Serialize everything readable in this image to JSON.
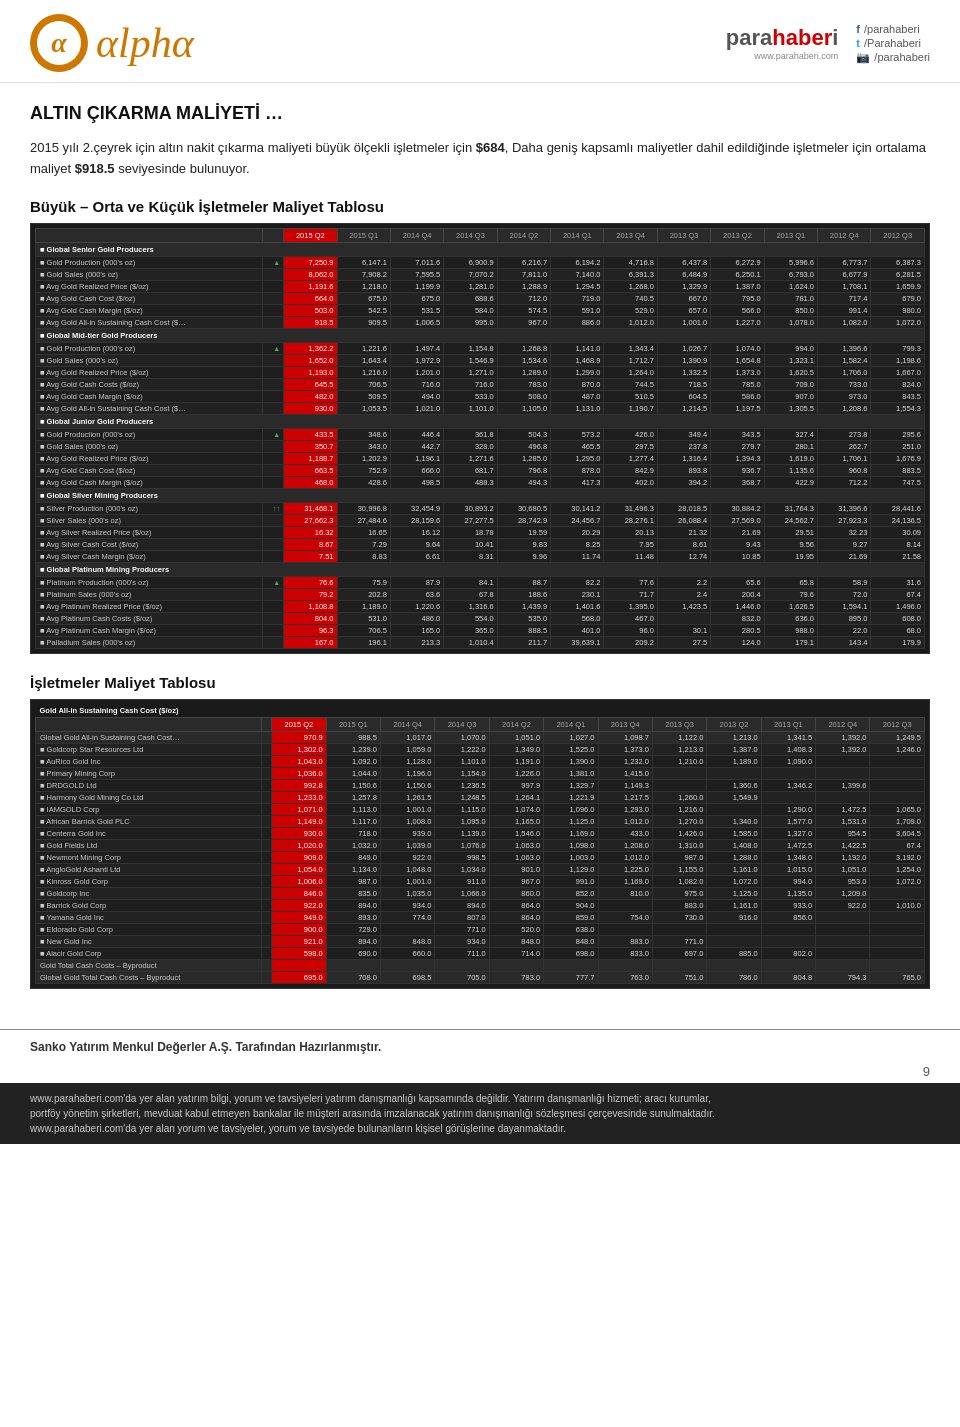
{
  "header": {
    "alpha_brand": "alpha",
    "alpha_symbol": "α",
    "parahaberi_name": "parahaberi",
    "parahaberi_url": "www.parahaberi.com",
    "social": {
      "facebook": "/parahaberi",
      "twitter": "/Parahaberi",
      "instagram": "/parahaberi"
    }
  },
  "page_title": "ALTIN ÇIKARMA MALİYETİ …",
  "body_text1": "2015 yılı 2.çeyrek için altın nakit çıkarma maliyeti büyük ölçekli işletmeler için ",
  "body_highlight1": "$684",
  "body_text2": ", Daha geniş kapsamlı maliyetler dahil edildiğinde işletmeler için ortalama maliyet ",
  "body_highlight2": "$918.5",
  "body_text3": " seviyesinde bulunuyor.",
  "section1_title": "Büyük – Orta ve Küçük İşletmeler Maliyet Tablosu",
  "section2_title": "İşletmeler Maliyet Tablosu",
  "table1": {
    "headers": [
      "",
      "",
      "2015 Q2",
      "2015 Q1",
      "2014 Q4",
      "2014 Q3",
      "2014 Q2",
      "2014 Q1",
      "2013 Q4",
      "2013 Q3",
      "2013 Q2",
      "2013 Q1",
      "2012 Q4",
      "2012 Q3"
    ],
    "sections": [
      {
        "name": "Global Senior Gold Producers",
        "rows": [
          [
            "Gold Production (000's oz)",
            "↑",
            "7,250.9",
            "6,147.1",
            "7,011.6",
            "6,900.9",
            "6,216.7",
            "6,194.2",
            "4,716.8",
            "6,437.8",
            "6,272.9",
            "5,996.6",
            "6,773.7",
            "6,387.3"
          ],
          [
            "Gold Sales (000's oz)",
            "",
            "8,062.0",
            "7,908.2",
            "7,595.5",
            "7,070.2",
            "7,811.0",
            "7,140.0",
            "6,391.3",
            "6,484.9",
            "6,250.1",
            "6,793.0",
            "6,677.9",
            "6,281.5"
          ],
          [
            "Avg Gold Realized Price ($/oz)",
            "",
            "1,191.6",
            "1,218.0",
            "1,199.9",
            "1,281.0",
            "1,288.9",
            "1,294.5",
            "1,268.0",
            "1,329.9",
            "1,387.0",
            "1,624.0",
            "1,708.1",
            "1,659.9"
          ],
          [
            "Avg Gold Cash Cost ($/oz)",
            "",
            "664.0",
            "675.0",
            "675.0",
            "688.6",
            "712.0",
            "719.0",
            "740.5",
            "667.0",
            "795.0",
            "781.0",
            "717.4",
            "679.0"
          ],
          [
            "Avg Gold Cash Margin ($/oz)",
            "",
            "503.0",
            "542.5",
            "531.5",
            "584.0",
            "574.5",
            "591.0",
            "529.0",
            "657.0",
            "566.0",
            "850.0",
            "991.4",
            "980.0"
          ],
          [
            "Avg Gold All-in Sustaining Cash Cost ($…",
            "",
            "918.5",
            "909.5",
            "1,006.5",
            "995.0",
            "967.0",
            "886.0",
            "1,012.0",
            "1,001.0",
            "1,227.0",
            "1,078.0",
            "1,082.0",
            "1,072.0"
          ]
        ]
      },
      {
        "name": "Global Mid-tier Gold Producers",
        "rows": [
          [
            "Gold Production (000's oz)",
            "↑",
            "1,362.2",
            "1,221.6",
            "1,497.4",
            "1,154.8",
            "1,268.8",
            "1,141.0",
            "1,343.4",
            "1,026.7",
            "1,074.0",
            "994.0",
            "1,396.6",
            "799.3"
          ],
          [
            "Gold Sales (000's oz)",
            "",
            "1,652.0",
            "1,643.4",
            "1,972.9",
            "1,546.9",
            "1,534.6",
            "1,468.9",
            "1,712.7",
            "1,390.9",
            "1,654.8",
            "1,323.1",
            "1,582.4",
            "1,198.6"
          ],
          [
            "Avg Gold Realized Price ($/oz)",
            "",
            "1,193.0",
            "1,216.0",
            "1,201.0",
            "1,271.0",
            "1,289.0",
            "1,299.0",
            "1,264.0",
            "1,332.5",
            "1,373.0",
            "1,620.5",
            "1,706.0",
            "1,667.0"
          ],
          [
            "Avg Gold Cash Costs ($/oz)",
            "",
            "645.5",
            "706.5",
            "716.0",
            "716.0",
            "783.0",
            "870.0",
            "744.5",
            "718.5",
            "785.0",
            "709.0",
            "733.0",
            "824.0"
          ],
          [
            "Avg Gold Cash Margin ($/oz)",
            "",
            "482.0",
            "509.5",
            "494.0",
            "533.0",
            "508.0",
            "487.0",
            "510.5",
            "604.5",
            "586.0",
            "907.0",
            "973.0",
            "843.5"
          ],
          [
            "Avg Gold All-in Sustaining Cash Cost ($…",
            "",
            "930.0",
            "1,053.5",
            "1,021.0",
            "1,101.0",
            "1,105.0",
            "1,131.0",
            "1,190.7",
            "1,214.5",
            "1,197.5",
            "1,305.5",
            "1,208.6",
            "1,554.3"
          ]
        ]
      },
      {
        "name": "Global Junior Gold Producers",
        "rows": [
          [
            "Gold Production (000's oz)",
            "↑",
            "433.5",
            "348.6",
            "446.4",
            "361.8",
            "504.3",
            "573.2",
            "426.0",
            "349.4",
            "343.5",
            "327.4",
            "273.8",
            "295.6"
          ],
          [
            "Gold Sales (000's oz)",
            "",
            "350.7",
            "343.0",
            "442.7",
            "328.0",
            "496.8",
            "465.5",
            "297.5",
            "237.8",
            "279.7",
            "280.1",
            "262.7",
            "251.0"
          ],
          [
            "Avg Gold Realized Price ($/oz)",
            "",
            "1,188.7",
            "1,202.9",
            "1,196.1",
            "1,271.6",
            "1,285.0",
            "1,295.0",
            "1,277.4",
            "1,316.4",
            "1,394.3",
            "1,619.0",
            "1,706.1",
            "1,676.9"
          ],
          [
            "Avg Gold Cash Cost ($/oz)",
            "",
            "663.5",
            "752.9",
            "666.0",
            "681.7",
            "796.8",
            "878.0",
            "842.9",
            "893.8",
            "936.7",
            "1,135.6",
            "960.8",
            "883.5"
          ],
          [
            "Avg Gold Cash Margin ($/oz)",
            "",
            "468.0",
            "428.6",
            "498.5",
            "488.3",
            "494.3",
            "417.3",
            "402.0",
            "394.2",
            "368.7",
            "422.9",
            "712.2",
            "747.5"
          ]
        ]
      },
      {
        "name": "Global Silver Mining Producers",
        "rows": [
          [
            "Silver Production (000's oz)",
            "↑↑",
            "31,468.1",
            "30,996.8",
            "32,454.9",
            "30,893.2",
            "30,680.5",
            "30,141.2",
            "31,496.3",
            "28,018.5",
            "30,884.2",
            "31,764.3",
            "31,396.6",
            "28,441.6"
          ],
          [
            "Silver Sales (000's oz)",
            "",
            "27,662.3",
            "27,484.6",
            "28,159.6",
            "27,277.5",
            "28,742.9",
            "24,456.7",
            "28,276.1",
            "26,088.4",
            "27,569.0",
            "24,562.7",
            "27,923.3",
            "24,136.5"
          ],
          [
            "Avg Silver Realized Price ($/oz)",
            "",
            "16.32",
            "16.65",
            "16.12",
            "18.78",
            "19.59",
            "20.29",
            "20.13",
            "21.32",
            "21.69",
            "29.51",
            "32.23",
            "30.09"
          ],
          [
            "Avg Silver Cash Cost ($/oz)",
            "",
            "8.67",
            "7.29",
            "9.64",
            "10.41",
            "9.83",
            "8.25",
            "7.95",
            "8.61",
            "9.43",
            "9.56",
            "9.27",
            "8.14"
          ],
          [
            "Avg Silver Cash Margin ($/oz)",
            "",
            "7.51",
            "8.83",
            "6.61",
            "8.31",
            "9.96",
            "11.74",
            "11.48",
            "12.74",
            "10.85",
            "19.95",
            "21.69",
            "21.58"
          ]
        ]
      },
      {
        "name": "Global Platinum Mining Producers",
        "rows": [
          [
            "Platinum Production (000's oz)",
            "↑",
            "76.6",
            "75.9",
            "87.9",
            "84.1",
            "88.7",
            "82.2",
            "77.6",
            "2.2",
            "65.6",
            "65.8",
            "58.9",
            "31.6"
          ],
          [
            "Platinum Sales (000's oz)",
            "",
            "79.2",
            "202.8",
            "63.6",
            "67.8",
            "188.6",
            "230.1",
            "71.7",
            "2.4",
            "200.4",
            "79.6",
            "72.0",
            "67.4"
          ],
          [
            "Avg Platinum Realized Price ($/oz)",
            "",
            "1,108.8",
            "1,189.0",
            "1,220.6",
            "1,316.6",
            "1,439.9",
            "1,401.6",
            "1,395.0",
            "1,423.5",
            "1,446.0",
            "1,626.5",
            "1,594.1",
            "1,496.0"
          ],
          [
            "Avg Platinum Cash Costs ($/oz)",
            "",
            "804.0",
            "531.0",
            "486.0",
            "554.0",
            "535.0",
            "568.0",
            "467.0",
            "",
            "832.0",
            "636.0",
            "895.0",
            "608.0"
          ],
          [
            "Avg Platinum Cash Margin ($/oz)",
            "",
            "96.3",
            "706.5",
            "165.0",
            "365.0",
            "888.5",
            "401.0",
            "96.0",
            "30.1",
            "280.5",
            "988.0",
            "22.0",
            "68.0"
          ],
          [
            "Palladium Sales (000's oz)",
            "",
            "167.0",
            "196.1",
            "213.3",
            "1,010.4",
            "211.7",
            "39,639.1",
            "209.2",
            "27.5",
            "124.0",
            "179.1",
            "143.4",
            "179.9"
          ]
        ]
      }
    ]
  },
  "table2": {
    "headers": [
      "",
      "",
      "2015 Q2",
      "2015 Q1",
      "2014 Q4",
      "2014 Q3",
      "2014 Q2",
      "2014 Q1",
      "2013 Q4",
      "2013 Q3",
      "2013 Q2",
      "2013 Q1",
      "2012 Q4",
      "2012 Q3"
    ],
    "header_label": "Gold All-in Sustaining Cash Cost ($/oz)",
    "rows": [
      [
        "Global Gold All-in Sustaining Cash Cost…",
        "",
        "970.9",
        "988.5",
        "1,017.0",
        "1,070.0",
        "1,051.0",
        "1,027.0",
        "1,098.7",
        "1,122.0",
        "1,213.0",
        "1,341.5",
        "1,392.0",
        "1,249.5"
      ],
      [
        "Goldcorp Star Resources Ltd",
        "",
        "1,302.0",
        "1,239.0",
        "1,059.0",
        "1,222.0",
        "1,349.0",
        "1,525.0",
        "1,373.0",
        "1,213.0",
        "1,387.0",
        "1,408.3",
        "1,392.0",
        "1,246.0"
      ],
      [
        "AuRico Gold Inc",
        "",
        "1,043.0",
        "1,092.0",
        "1,128.0",
        "1,101.0",
        "1,191.0",
        "1,390.0",
        "1,232.0",
        "1,210.0",
        "1,189.0",
        "1,090.0",
        "",
        ""
      ],
      [
        "Primary Mining Corp",
        "",
        "1,036.0",
        "1,044.0",
        "1,196.0",
        "1,154.0",
        "1,226.0",
        "1,381.0",
        "1,415.0",
        "",
        "",
        "",
        "",
        ""
      ],
      [
        "DRDGOLD Ltd",
        "",
        "992.8",
        "1,150.6",
        "1,150.6",
        "1,236.5",
        "997.9",
        "1,329.7",
        "1,149.3",
        "",
        "1,360.6",
        "1,346.2",
        "1,399.6"
      ],
      [
        "Harmony Gold Mining Co Ltd",
        "",
        "1,233.0",
        "1,257.8",
        "1,261.5",
        "1,248.5",
        "1,264.1",
        "1,221.9",
        "1,217.5",
        "1,260.0",
        "1,549.9",
        "",
        "",
        ""
      ],
      [
        "IAMGOLD Corp",
        "",
        "1,071.0",
        "1,113.0",
        "1,001.0",
        "1,115.0",
        "1,074.0",
        "1,096.0",
        "1,293.0",
        "1,216.0",
        "",
        "1,290.0",
        "1,472.5",
        "1,065.0"
      ],
      [
        "African Barrick Gold PLC",
        "",
        "1,149.0",
        "1,117.0",
        "1,008.0",
        "1,095.0",
        "1,165.0",
        "1,125.0",
        "1,012.0",
        "1,270.0",
        "1,340.0",
        "1,577.0",
        "1,531.0",
        "1,709.0"
      ],
      [
        "Centerra Gold Inc",
        "",
        "930.0",
        "718.0",
        "939.0",
        "1,139.0",
        "1,546.0",
        "1,169.0",
        "433.0",
        "1,426.0",
        "1,585.0",
        "1,327.0",
        "954.5",
        "3,604.5"
      ],
      [
        "Gold Fields Ltd",
        "",
        "1,020.0",
        "1,032.0",
        "1,039.0",
        "1,076.0",
        "1,063.0",
        "1,098.0",
        "1,208.0",
        "1,310.0",
        "1,408.0",
        "1,472.5",
        "1,422.5",
        "67.4"
      ],
      [
        "Newmont Mining Corp",
        "",
        "909.0",
        "849.0",
        "922.0",
        "998.5",
        "1,063.0",
        "1,003.0",
        "1,012.0",
        "987.0",
        "1,288.0",
        "1,348.0",
        "1,192.0",
        "3,192.0"
      ],
      [
        "AngloGold Ashanti Ltd",
        "",
        "1,054.0",
        "1,134.0",
        "1,048.0",
        "1,034.0",
        "901.0",
        "1,129.0",
        "1,225.0",
        "1,155.0",
        "1,161.0",
        "1,015.0",
        "1,051.0",
        "1,254.0"
      ],
      [
        "Kinross Gold Corp",
        "",
        "1,006.0",
        "987.0",
        "1,001.0",
        "911.0",
        "967.0",
        "991.0",
        "1,169.0",
        "1,082.0",
        "1,072.0",
        "994.0",
        "953.0",
        "1,072.0"
      ],
      [
        "Goldcorp Inc",
        "",
        "846.0",
        "835.0",
        "1,035.0",
        "1,066.0",
        "860.0",
        "852.0",
        "810.0",
        "975.0",
        "1,125.0",
        "1,135.0",
        "1,209.0",
        ""
      ],
      [
        "Barrick Gold Corp",
        "",
        "922.0",
        "894.0",
        "934.0",
        "894.0",
        "864.0",
        "904.0",
        "",
        "883.0",
        "1,161.0",
        "933.0",
        "922.0",
        "1,010.0"
      ],
      [
        "Yamana Gold Inc",
        "",
        "949.0",
        "893.0",
        "774.0",
        "807.0",
        "864.0",
        "859.0",
        "754.0",
        "730.0",
        "916.0",
        "856.0",
        "",
        ""
      ],
      [
        "Eldorado Gold Corp",
        "",
        "900.0",
        "729.0",
        "",
        "771.0",
        "520.0",
        "638.0",
        "",
        "",
        "",
        "",
        "",
        ""
      ],
      [
        "New Gold Inc",
        "",
        "921.0",
        "894.0",
        "848.0",
        "934.0",
        "848.0",
        "848.0",
        "883.0",
        "771.0",
        "",
        "",
        "",
        ""
      ],
      [
        "Alacir Gold Corp",
        "",
        "598.0",
        "690.0",
        "660.0",
        "711.0",
        "714.0",
        "698.0",
        "833.0",
        "697.0",
        "885.0",
        "802.0",
        "",
        ""
      ],
      [
        "Gold Total Cash Costs – Byproduct",
        "",
        "",
        "",
        "",
        "",
        "",
        "",
        "",
        "",
        "",
        "",
        "",
        ""
      ],
      [
        "Global Gold Total Cash Costs – Byproduct",
        "",
        "695.0",
        "708.0",
        "698.5",
        "705.0",
        "783.0",
        "777.7",
        "763.0",
        "751.0",
        "786.0",
        "804.8",
        "794.3",
        "765.0"
      ]
    ]
  },
  "footer": {
    "company": "Sanko Yatırım Menkul Değerler A.Ş. Tarafından Hazırlanmıştır.",
    "disclaimer1": "www.parahaberi.com'da yer alan yatırım bilgi, yorum ve tavsiyeleri yatırım danışmanlığı kapsamında değildir. Yatırım danışmanlığı hizmeti; aracı kurumlar,",
    "disclaimer2": "portföy yönetim şirketleri, mevduat kabul etmeyen bankalar ile müşteri arasında imzalanacak yatırım danışmanlığı sözleşmesi çerçevesinde sunulmaktadır.",
    "disclaimer3": "www.parahaberi.com'da yer alan yorum ve tavsiyeler, yorum ve tavsiyede bulunanların kişisel görüşlerine dayanmaktadır.",
    "page_number": "9"
  }
}
